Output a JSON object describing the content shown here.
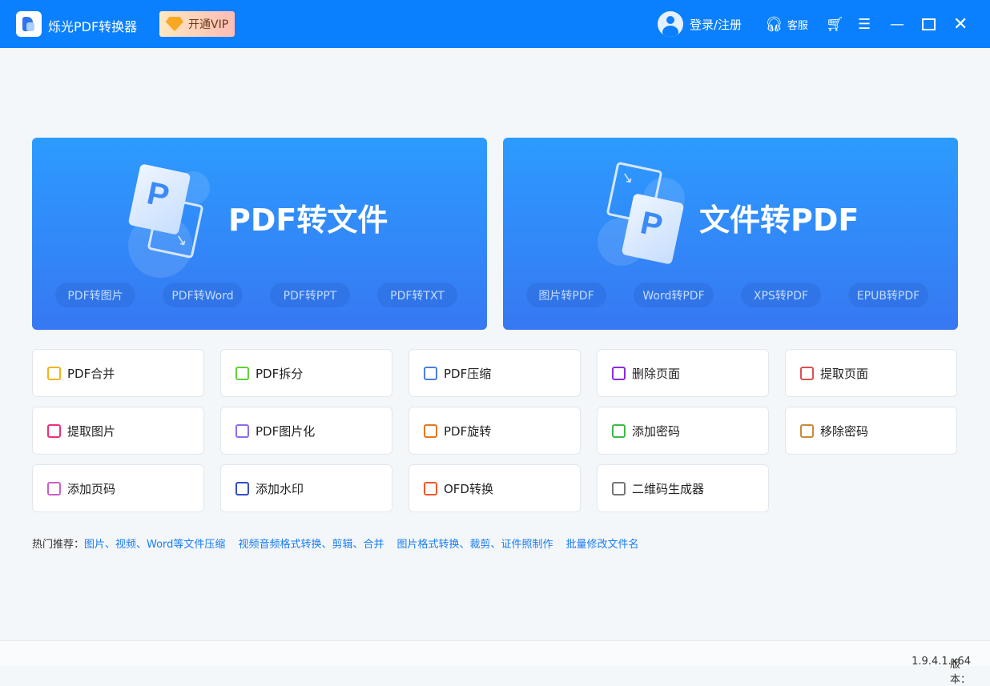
{
  "app": {
    "title": "烁光PDF转换器",
    "vip": "开通VIP",
    "login": "登录/注册",
    "service": "客服",
    "version_label": "版本：",
    "version": "1.9.4.1.x64"
  },
  "banners": [
    {
      "title": "PDF转文件",
      "links": [
        "PDF转图片",
        "PDF转Word",
        "PDF转PPT",
        "PDF转TXT"
      ]
    },
    {
      "title": "文件转PDF",
      "links": [
        "图片转PDF",
        "Word转PDF",
        "XPS转PDF",
        "EPUB转PDF"
      ]
    }
  ],
  "tools": [
    {
      "label": "PDF合并",
      "icon": "merge-icon",
      "color": "#f5b417"
    },
    {
      "label": "PDF拆分",
      "icon": "split-icon",
      "color": "#5fd13a"
    },
    {
      "label": "PDF压缩",
      "icon": "compress-icon",
      "color": "#4a7fe0"
    },
    {
      "label": "删除页面",
      "icon": "delete-page-icon",
      "color": "#8a2be2"
    },
    {
      "label": "提取页面",
      "icon": "extract-page-icon",
      "color": "#d9534f"
    },
    {
      "label": "提取图片",
      "icon": "extract-image-icon",
      "color": "#ef2f7a"
    },
    {
      "label": "PDF图片化",
      "icon": "pdf-to-image-icon",
      "color": "#8c6cf0"
    },
    {
      "label": "PDF旋转",
      "icon": "rotate-icon",
      "color": "#e8771c"
    },
    {
      "label": "添加密码",
      "icon": "lock-icon",
      "color": "#3fb94a"
    },
    {
      "label": "移除密码",
      "icon": "unlock-icon",
      "color": "#c98a3a"
    },
    {
      "label": "添加页码",
      "icon": "page-number-icon",
      "color": "#c860c8"
    },
    {
      "label": "添加水印",
      "icon": "watermark-icon",
      "color": "#2f4fc8"
    },
    {
      "label": "OFD转换",
      "icon": "ofd-icon",
      "color": "#f0582a"
    },
    {
      "label": "二维码生成器",
      "icon": "qrcode-icon",
      "color": "#777777"
    }
  ],
  "hot": {
    "label": "热门推荐：",
    "links": [
      "图片、视频、Word等文件压缩",
      "视频音频格式转换、剪辑、合并",
      "图片格式转换、裁剪、证件照制作",
      "批量修改文件名"
    ]
  }
}
